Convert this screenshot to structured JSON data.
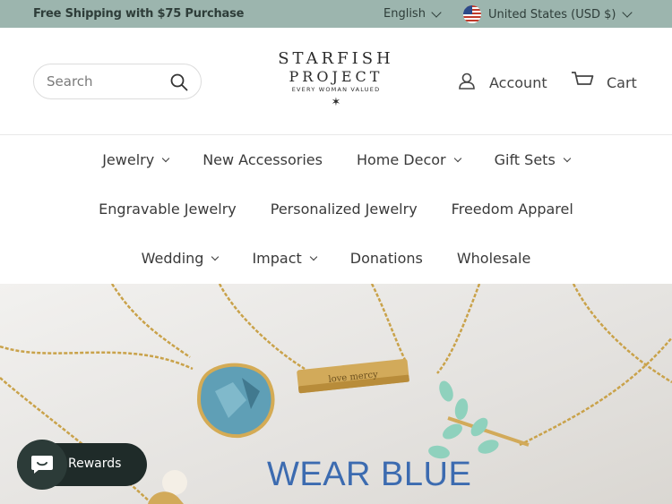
{
  "announcement": {
    "promo": "Free Shipping with $75 Purchase",
    "language": "English",
    "currency": "United States (USD $)"
  },
  "header": {
    "search_placeholder": "Search",
    "logo": {
      "line1": "STARFISH",
      "line2": "PROJECT",
      "tagline": "EVERY WOMAN VALUED",
      "mark": "✶"
    },
    "account_label": "Account",
    "cart_label": "Cart"
  },
  "nav": {
    "row1": [
      "Jewelry",
      "New Accessories",
      "Home Decor",
      "Gift Sets"
    ],
    "row2": [
      "Engravable Jewelry",
      "Personalized Jewelry",
      "Freedom Apparel"
    ],
    "row3": [
      "Wedding",
      "Impact",
      "Donations",
      "Wholesale"
    ]
  },
  "hero": {
    "title": "WEAR BLUE",
    "engraving": "love mercy"
  },
  "rewards": {
    "label": "Rewards"
  },
  "colors": {
    "announcement_bg": "#9cb5ae",
    "hero_title": "#3c6bb0",
    "rewards_bg": "#1f2b29"
  }
}
